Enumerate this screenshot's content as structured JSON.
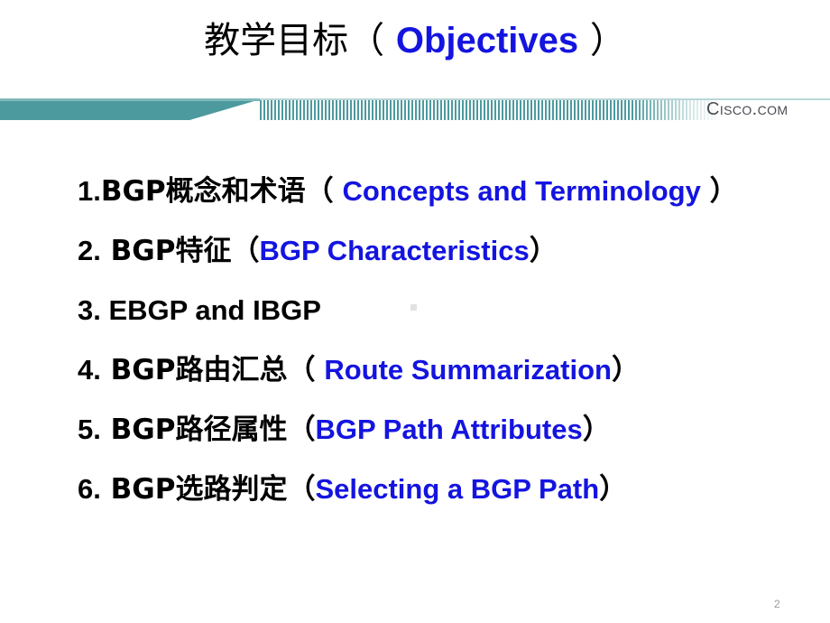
{
  "slide": {
    "title": {
      "cjk_prefix": "教学目标（",
      "english": "Objectives",
      "cjk_suffix": "）",
      "space_before_en": " ",
      "space_after_en": " ",
      "black_color": "#000000",
      "blue_color": "#1414e0"
    },
    "header": {
      "wordmark": "Cisco.com",
      "band_color": "#4d9a9e",
      "wordmark_color": "#4a4a52"
    },
    "bullets": [
      {
        "number": "1.",
        "cjk": "BGP概念和术语（",
        "english": "Concepts and Terminology",
        "close": "）",
        "space_before_en": " ",
        "space_after_en": " ",
        "english_color": "#1414e0"
      },
      {
        "number": "2.",
        "cjk": " BGP特征（",
        "english": "BGP Characteristics",
        "close": "）",
        "space_before_en": "",
        "space_after_en": "",
        "english_color": "#1414e0"
      },
      {
        "number": "3.",
        "cjk": "",
        "english": " EBGP and IBGP",
        "close": "",
        "space_before_en": "",
        "space_after_en": "",
        "english_color": "#000000"
      },
      {
        "number": "4.",
        "cjk": " BGP路由汇总（",
        "english": "Route Summarization",
        "close": "）",
        "space_before_en": " ",
        "space_after_en": "",
        "english_color": "#1414e0"
      },
      {
        "number": "5.",
        "cjk": " BGP路径属性（",
        "english": "BGP Path Attributes",
        "close": "）",
        "space_before_en": "",
        "space_after_en": "",
        "english_color": "#1414e0"
      },
      {
        "number": "6.",
        "cjk": " BGP选路判定（",
        "english": "Selecting a BGP Path",
        "close": "）",
        "space_before_en": "",
        "space_after_en": "",
        "english_color": "#1414e0"
      }
    ],
    "footer": {
      "page_number": "2"
    }
  }
}
